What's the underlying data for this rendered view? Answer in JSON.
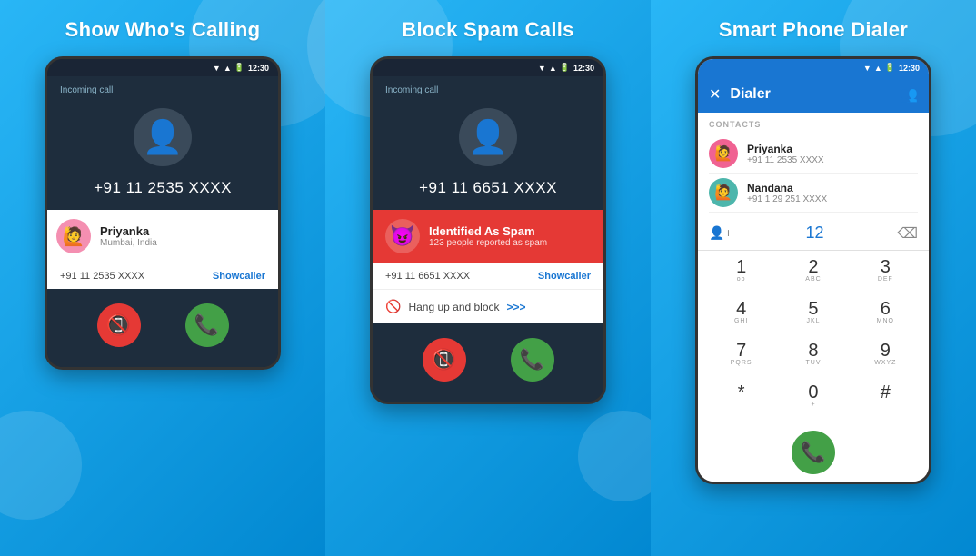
{
  "panel1": {
    "title": "Show Who's Calling",
    "status_time": "12:30",
    "incoming_label": "Incoming call",
    "phone_number": "+91 11 2535 XXXX",
    "caller_name": "Priyanka",
    "caller_location": "Mumbai, India",
    "caller_number": "+91 11 2535 XXXX",
    "showcaller": "Showcaller",
    "btn_decline": "📞",
    "btn_answer": "📞"
  },
  "panel2": {
    "title": "Block Spam Calls",
    "status_time": "12:30",
    "incoming_label": "Incoming call",
    "phone_number": "+91 11 6651 XXXX",
    "spam_title": "Identified As Spam",
    "spam_sub": "123 people reported as spam",
    "caller_number": "+91 11 6651 XXXX",
    "showcaller": "Showcaller",
    "hangup_text": "Hang up and block",
    "hangup_arrow": ">>>"
  },
  "panel3": {
    "title": "Smart Phone Dialer",
    "status_time": "12:30",
    "dialer_title": "Dialer",
    "contacts_label": "CONTACTS",
    "contacts": [
      {
        "name": "Priyanka",
        "number": "+91 11 2535 XXXX"
      },
      {
        "name": "Nandana",
        "number": "+91 1 29 251 XXXX"
      }
    ],
    "dialer_input": "12",
    "keypad": [
      {
        "num": "1",
        "alpha": "oo"
      },
      {
        "num": "2",
        "alpha": "ABC"
      },
      {
        "num": "3",
        "alpha": "DEF"
      },
      {
        "num": "4",
        "alpha": "GHI"
      },
      {
        "num": "5",
        "alpha": "JKL"
      },
      {
        "num": "6",
        "alpha": "MNO"
      },
      {
        "num": "7",
        "alpha": "PQRS"
      },
      {
        "num": "8",
        "alpha": "TUV"
      },
      {
        "num": "9",
        "alpha": "WXYZ"
      },
      {
        "num": "*",
        "alpha": ""
      },
      {
        "num": "0",
        "alpha": "+"
      },
      {
        "num": "#",
        "alpha": ""
      }
    ]
  }
}
